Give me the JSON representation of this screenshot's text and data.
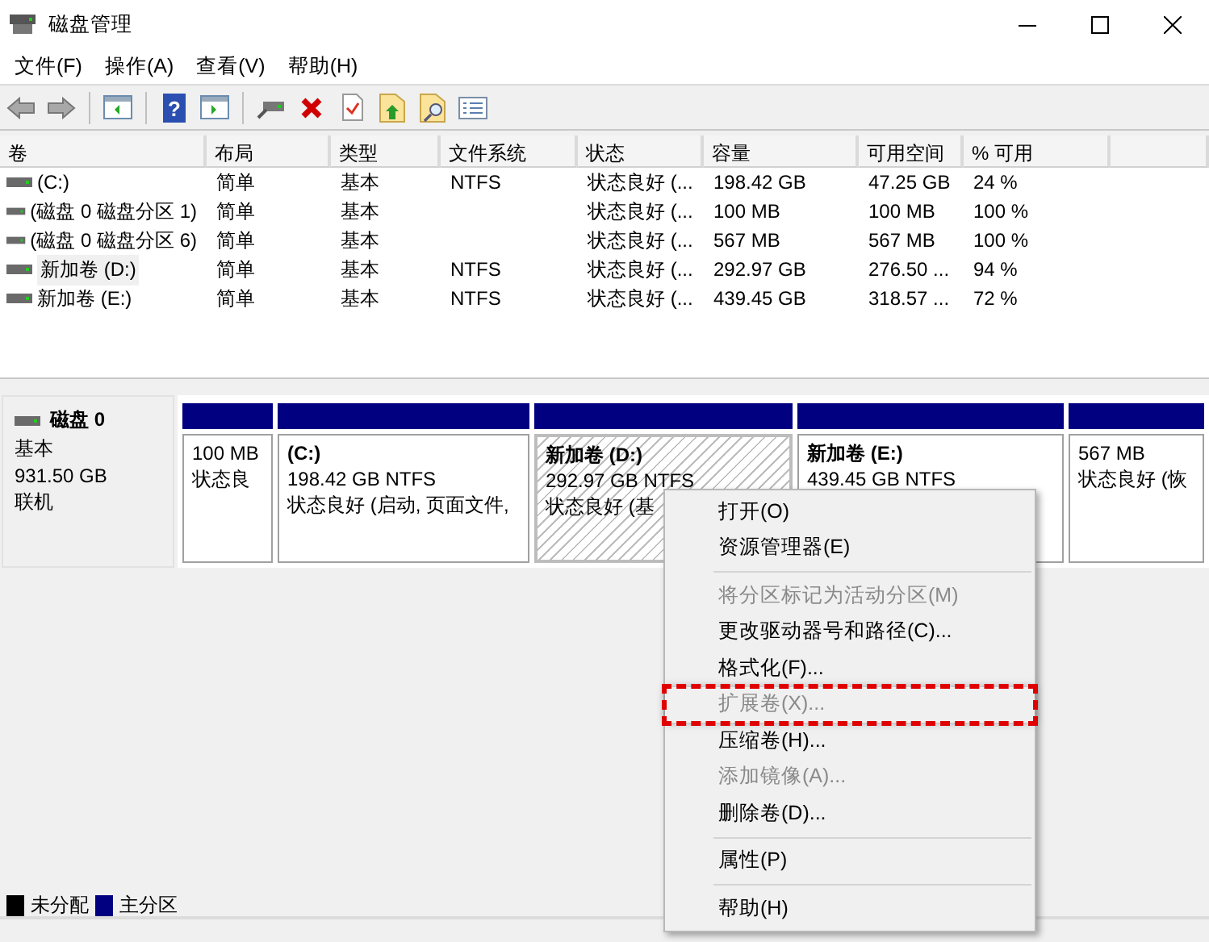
{
  "window": {
    "title": "磁盘管理"
  },
  "menu_bar": [
    "文件(F)",
    "操作(A)",
    "查看(V)",
    "帮助(H)"
  ],
  "toolbar": {
    "back_disabled": true,
    "forward_disabled": true,
    "help_glyph": "?"
  },
  "table": {
    "columns": [
      "卷",
      "布局",
      "类型",
      "文件系统",
      "状态",
      "容量",
      "可用空间",
      "% 可用"
    ],
    "rows": [
      {
        "selected": false,
        "cells": [
          " (C:)",
          "简单",
          "基本",
          "NTFS",
          "状态良好 (...",
          "198.42 GB",
          "47.25 GB",
          "24 %"
        ]
      },
      {
        "selected": false,
        "cells": [
          "(磁盘 0 磁盘分区 1)",
          "简单",
          "基本",
          "",
          "状态良好 (...",
          "100 MB",
          "100 MB",
          "100 %"
        ]
      },
      {
        "selected": false,
        "cells": [
          "(磁盘 0 磁盘分区 6)",
          "简单",
          "基本",
          "",
          "状态良好 (...",
          "567 MB",
          "567 MB",
          "100 %"
        ]
      },
      {
        "selected": true,
        "cells": [
          "新加卷 (D:)",
          "简单",
          "基本",
          "NTFS",
          "状态良好 (...",
          "292.97 GB",
          "276.50 ...",
          "94 %"
        ]
      },
      {
        "selected": false,
        "cells": [
          "新加卷 (E:)",
          "简单",
          "基本",
          "NTFS",
          "状态良好 (...",
          "439.45 GB",
          "318.57 ...",
          "72 %"
        ]
      }
    ]
  },
  "disk": {
    "name": "磁盘 0",
    "type": "基本",
    "size": "931.50 GB",
    "status": "联机",
    "partitions": [
      {
        "kind": "primary",
        "selected": false,
        "size": "100 MB",
        "status": "状态良"
      },
      {
        "kind": "primary",
        "selected": false,
        "name": " (C:)",
        "size": "198.42 GB NTFS",
        "status": "状态良好 (启动, 页面文件,"
      },
      {
        "kind": "primary",
        "selected": true,
        "name": "新加卷  (D:)",
        "size": "292.97 GB NTFS",
        "status": "状态良好 (基"
      },
      {
        "kind": "primary",
        "selected": false,
        "name": "新加卷  (E:)",
        "size": "439.45 GB NTFS"
      },
      {
        "kind": "primary",
        "selected": false,
        "size": "567 MB",
        "status": "状态良好 (恢"
      }
    ]
  },
  "legend": [
    {
      "label": "未分配",
      "color": "#000000"
    },
    {
      "label": "主分区",
      "color": "#000080"
    }
  ],
  "context_menu": [
    {
      "kind": "item",
      "label": "打开(O)",
      "disabled": false,
      "highlighted": false
    },
    {
      "kind": "item",
      "label": "资源管理器(E)",
      "disabled": false,
      "highlighted": false
    },
    {
      "kind": "separator"
    },
    {
      "kind": "item",
      "label": "将分区标记为活动分区(M)",
      "disabled": true,
      "highlighted": false
    },
    {
      "kind": "item",
      "label": "更改驱动器号和路径(C)...",
      "disabled": false,
      "highlighted": false
    },
    {
      "kind": "item",
      "label": "格式化(F)...",
      "disabled": false,
      "highlighted": false
    },
    {
      "kind": "item",
      "label": "扩展卷(X)...",
      "disabled": true,
      "highlighted": true
    },
    {
      "kind": "item",
      "label": "压缩卷(H)...",
      "disabled": false,
      "highlighted": false
    },
    {
      "kind": "item",
      "label": "添加镜像(A)...",
      "disabled": true,
      "highlighted": false
    },
    {
      "kind": "item",
      "label": "删除卷(D)...",
      "disabled": false,
      "highlighted": false
    },
    {
      "kind": "separator"
    },
    {
      "kind": "item",
      "label": "属性(P)",
      "disabled": false,
      "highlighted": false
    },
    {
      "kind": "separator"
    },
    {
      "kind": "item",
      "label": "帮助(H)",
      "disabled": false,
      "highlighted": false
    }
  ]
}
